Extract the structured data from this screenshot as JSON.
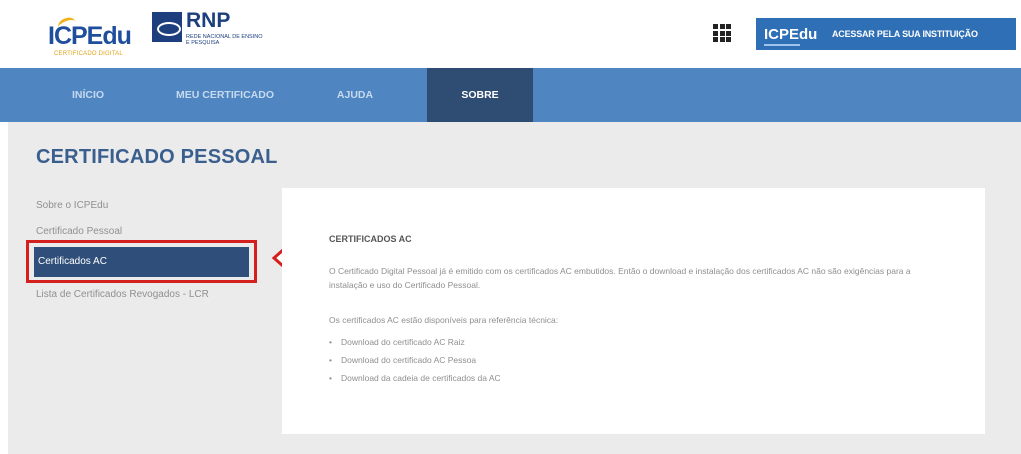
{
  "header": {
    "icpedu_logo": "ICPEdu",
    "icpedu_sub": "CERTIFICADO DIGITAL",
    "rnp_logo": "RNP",
    "rnp_sub": "REDE NACIONAL DE ENSINO E PESQUISA",
    "apps_icon": "grid-apps-icon",
    "access_mini": "ICPEdu",
    "access_label": "ACESSAR PELA SUA INSTITUIÇÃO"
  },
  "nav": {
    "items": [
      "INÍCIO",
      "MEU CERTIFICADO",
      "AJUDA",
      "SOBRE"
    ],
    "active": "SOBRE"
  },
  "page": {
    "title": "CERTIFICADO PESSOAL"
  },
  "sidebar": {
    "items": [
      "Sobre o ICPEdu",
      "Certificado Pessoal",
      "Certificados AC",
      "Lista de Certificados Revogados - LCR"
    ],
    "active": "Certificados AC"
  },
  "content": {
    "heading": "CERTIFICADOS AC",
    "paragraph": "O Certificado Digital Pessoal já é emitido com os certificados AC embutidos. Então o download e instalação dos certificados AC não são exigências para a instalação e uso do Certificado Pessoal.",
    "intro": "Os certificados AC estão disponíveis para referência técnica:",
    "links": [
      "Download do certificado AC Raiz",
      "Download do certificado AC Pessoa",
      "Download da cadeia de certificados da AC"
    ]
  },
  "colors": {
    "nav_bg": "#4f86c1",
    "nav_active": "#2f4c73",
    "title": "#3a5f8e",
    "highlight_red": "#d41f1f",
    "access_btn": "#2f6fb6"
  }
}
